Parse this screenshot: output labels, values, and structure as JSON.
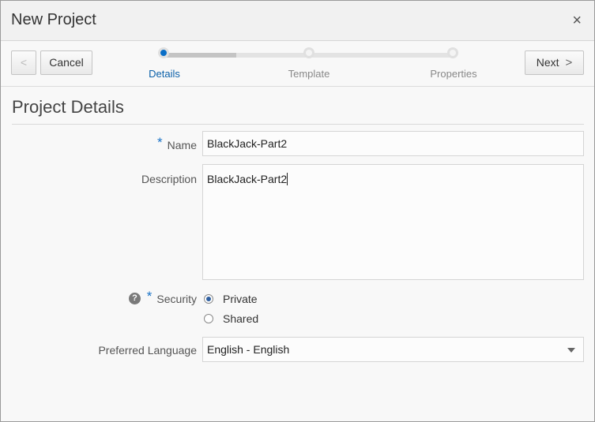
{
  "dialog": {
    "title": "New Project",
    "close_glyph": "×"
  },
  "toolbar": {
    "back_glyph": "<",
    "cancel_label": "Cancel",
    "next_label": "Next",
    "next_glyph": ">"
  },
  "train": {
    "steps": [
      {
        "label": "Details",
        "state": "active"
      },
      {
        "label": "Template",
        "state": "pending"
      },
      {
        "label": "Properties",
        "state": "pending"
      }
    ]
  },
  "section": {
    "title": "Project Details"
  },
  "form": {
    "name_label": "Name",
    "name_value": "BlackJack-Part2",
    "description_label": "Description",
    "description_value": "BlackJack-Part2",
    "security_label": "Security",
    "security_options": [
      {
        "label": "Private",
        "checked": true
      },
      {
        "label": "Shared",
        "checked": false
      }
    ],
    "help_glyph": "?",
    "required_mark": "*",
    "language_label": "Preferred Language",
    "language_value": "English - English"
  },
  "colors": {
    "accent": "#0a6ec7",
    "required": "#1a73c7"
  }
}
